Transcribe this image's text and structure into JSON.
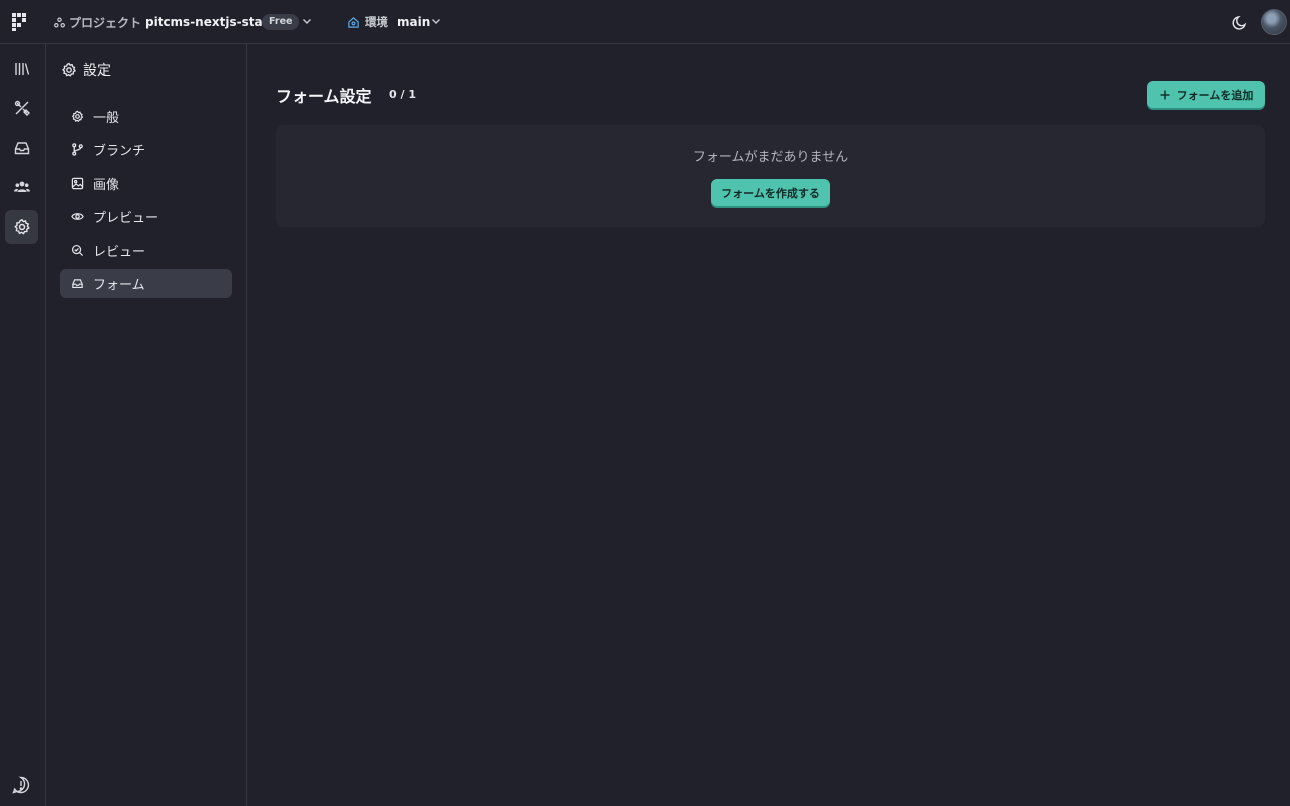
{
  "topbar": {
    "project_label": "プロジェクト",
    "project_name": "pitcms-nextjs-starter",
    "plan_badge": "Free",
    "env_label": "環境",
    "env_name": "main"
  },
  "rail": {
    "items": [
      {
        "icon": "library-icon"
      },
      {
        "icon": "design-tools-icon"
      },
      {
        "icon": "inbox-icon"
      },
      {
        "icon": "users-icon"
      },
      {
        "icon": "settings-icon",
        "active": true
      }
    ],
    "help_icon": "help-alert-icon"
  },
  "sidebar": {
    "title": "設定",
    "items": [
      {
        "label": "一般",
        "icon": "gear-icon"
      },
      {
        "label": "ブランチ",
        "icon": "branch-icon"
      },
      {
        "label": "画像",
        "icon": "image-icon"
      },
      {
        "label": "プレビュー",
        "icon": "eye-icon"
      },
      {
        "label": "レビュー",
        "icon": "review-icon"
      },
      {
        "label": "フォーム",
        "icon": "inbox-icon",
        "active": true
      }
    ]
  },
  "main": {
    "title": "フォーム設定",
    "counter": "0 / 1",
    "add_button": "フォームを追加",
    "empty_message": "フォームがまだありません",
    "create_button": "フォームを作成する"
  },
  "colors": {
    "background": "#20212b",
    "accent": "#4fc3ae",
    "card": "#262730",
    "active_item": "#3a3c47"
  }
}
